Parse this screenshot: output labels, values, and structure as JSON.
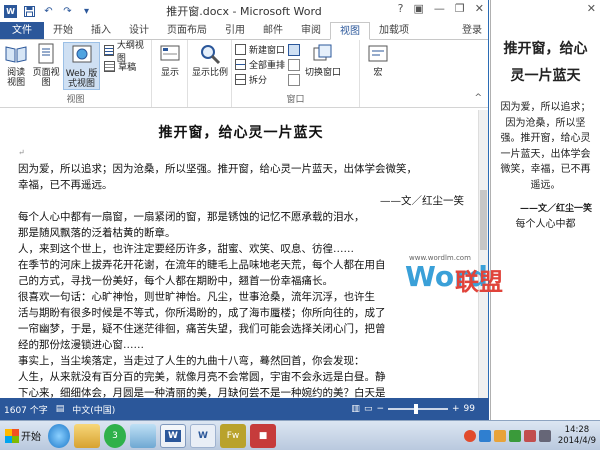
{
  "window": {
    "doc_title": "推开窗.docx - Microsoft Word",
    "minimize": "—",
    "restore": "❐",
    "close": "✕"
  },
  "tabs": [
    "文件",
    "开始",
    "插入",
    "设计",
    "页面布局",
    "引用",
    "邮件",
    "审阅",
    "视图",
    "加载项"
  ],
  "active_tab": "视图",
  "login_label": "登录",
  "ribbon": {
    "views": {
      "label": "视图",
      "read_mode": "阅读\n视图",
      "print_layout": "页面视图",
      "web_layout": "Web 版式视图",
      "outline": "大纲视图",
      "draft": "草稿"
    },
    "show": {
      "label": "显示"
    },
    "zoom": {
      "label": "显示比例"
    },
    "window": {
      "label": "窗口",
      "new_window": "新建窗口",
      "arrange_all": "全部重排",
      "split": "拆分",
      "switch_windows": "切换窗口"
    },
    "macros": {
      "label": "宏"
    }
  },
  "document": {
    "title": "推开窗，给心灵一片蓝天",
    "lines": [
      "因为爱，所以追求；因为沧桑，所以坚强。推开窗，给心灵一片蓝天，出体学会微笑，",
      "幸福，已不再遥远。",
      "——文／红尘一笑",
      "    每个人心中都有一扇窗，一扇紧闭的窗，那是锈蚀的记忆不愿承载的泪水，",
      "那是随风飘落的泛着枯黄的断章。",
      "    人，来到这个世上，也许注定要经历许多，甜蜜、欢笑、叹息、彷徨……",
      "在季节的河床上拔弄花开花谢，在流年的睫毛上品味地老天荒，每个人都在用自",
      "己的方式，寻找一份美好，每个人都在期盼中，翘首一份幸福痛长。",
      "    很喜欢一句话：心旷神怡，则世旷神怡。凡尘，世事沧桑，流年沉浮，也许生",
      "活与期盼有很多时候是不等式，你所渴盼的，成了海市蜃楼；你所向往的，成了",
      "一帘幽梦，于是，疑不住迷茫徘徊，痛苦失望，我们可能会选择关闭心门，把曾",
      "经的那份炫漫锁进心窗……",
      "    事实上，当尘埃落定，当走过了人生的九曲十八弯，蓦然回首，你会发现：",
      "人生，从来就没有百分百的完美，就像月亮不会常圆，宇宙不会永远是白昼。静",
      "下心来，细细体会，月圆是一种清丽的美，月缺何尝不是一种婉约的美？白天是"
    ]
  },
  "status": {
    "word_count": "1607 个字",
    "language": "中文(中国)",
    "zoom_percent": "99"
  },
  "zoom_level": 0.99,
  "reading_pane": {
    "title": "推开窗，给心灵一片蓝天",
    "body": "因为爱，所以追求；因为沧桑，所以坚强。推开窗，给心灵一片蓝天，出体学会微笑，幸福，已不再遥远。",
    "author": "——文／红尘一笑",
    "tail": "每个人心中都"
  },
  "watermark": {
    "brand_left": "Word",
    "brand_right": "联盟",
    "url": "www.wordlm.com"
  },
  "taskbar": {
    "start_label": "开始",
    "item_3": "3",
    "clock_time": "14:28",
    "clock_date": "2014/4/9"
  },
  "colors": {
    "accent": "#2b579a",
    "file_tab": "#2b579a",
    "selected_button": "#cfe0f3"
  }
}
